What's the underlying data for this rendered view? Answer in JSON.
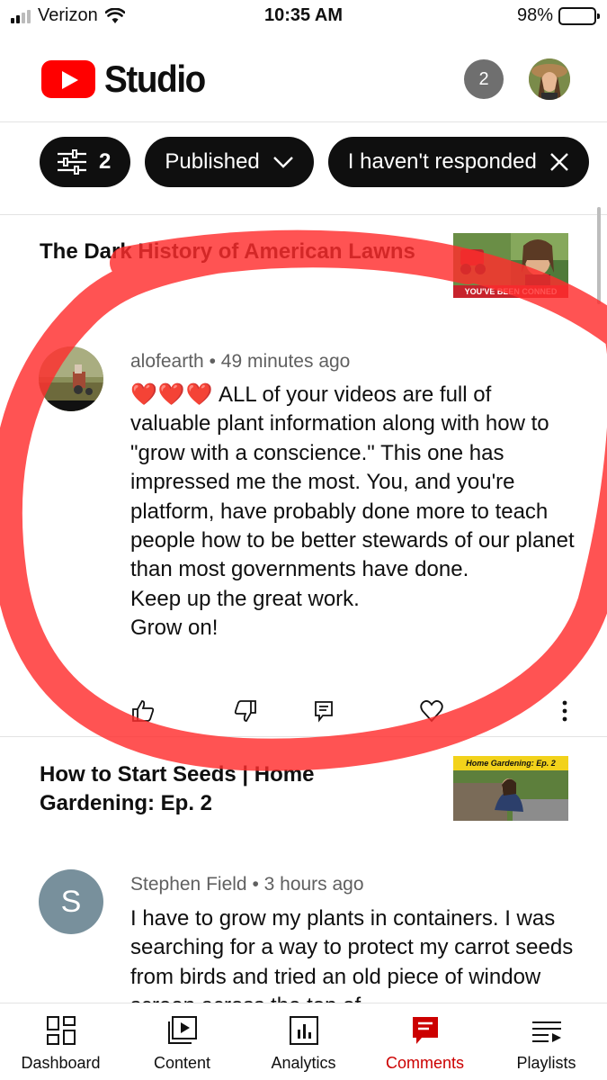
{
  "status_bar": {
    "carrier": "Verizon",
    "time": "10:35 AM",
    "battery": "98%",
    "battery_level": 0.98
  },
  "header": {
    "logo_text": "Studio",
    "notification_count": "2"
  },
  "filters": {
    "filter_count": "2",
    "published": "Published",
    "responded": "I haven't responded"
  },
  "video1": {
    "title": "The Dark History of American Lawns",
    "thumb_text": "YOU'VE BEEN CONNED"
  },
  "comment1": {
    "author": "alofearth",
    "time": "49 minutes ago",
    "hearts": "❤️❤️❤️",
    "lines": [
      "ALL of your videos are full of valuable plant information along with how to \"grow with a conscience.\"  This one has impressed me the most.  You, and you're platform, have probably done more to teach people how to be better stewards of our planet than most governments have done.",
      "Keep up the great work.",
      "Grow on!"
    ]
  },
  "video2": {
    "title": "How to Start Seeds | Home Gardening: Ep. 2",
    "thumb_text": "Home Gardening: Ep. 2"
  },
  "comment2": {
    "author": "Stephen Field",
    "time": "3 hours ago",
    "avatar_letter": "S",
    "text": "I have to grow my plants in containers.  I was searching for a way to protect my carrot seeds from birds and tried an old piece of window screen across the top of"
  },
  "bottom_nav": [
    {
      "label": "Dashboard",
      "icon": "dashboard-icon"
    },
    {
      "label": "Content",
      "icon": "content-icon"
    },
    {
      "label": "Analytics",
      "icon": "analytics-icon"
    },
    {
      "label": "Comments",
      "icon": "comments-icon"
    },
    {
      "label": "Playlists",
      "icon": "playlists-icon"
    }
  ],
  "colors": {
    "accent": "#cc0000",
    "youtube_red": "#ff0000",
    "annotation": "#ff2d2d"
  }
}
